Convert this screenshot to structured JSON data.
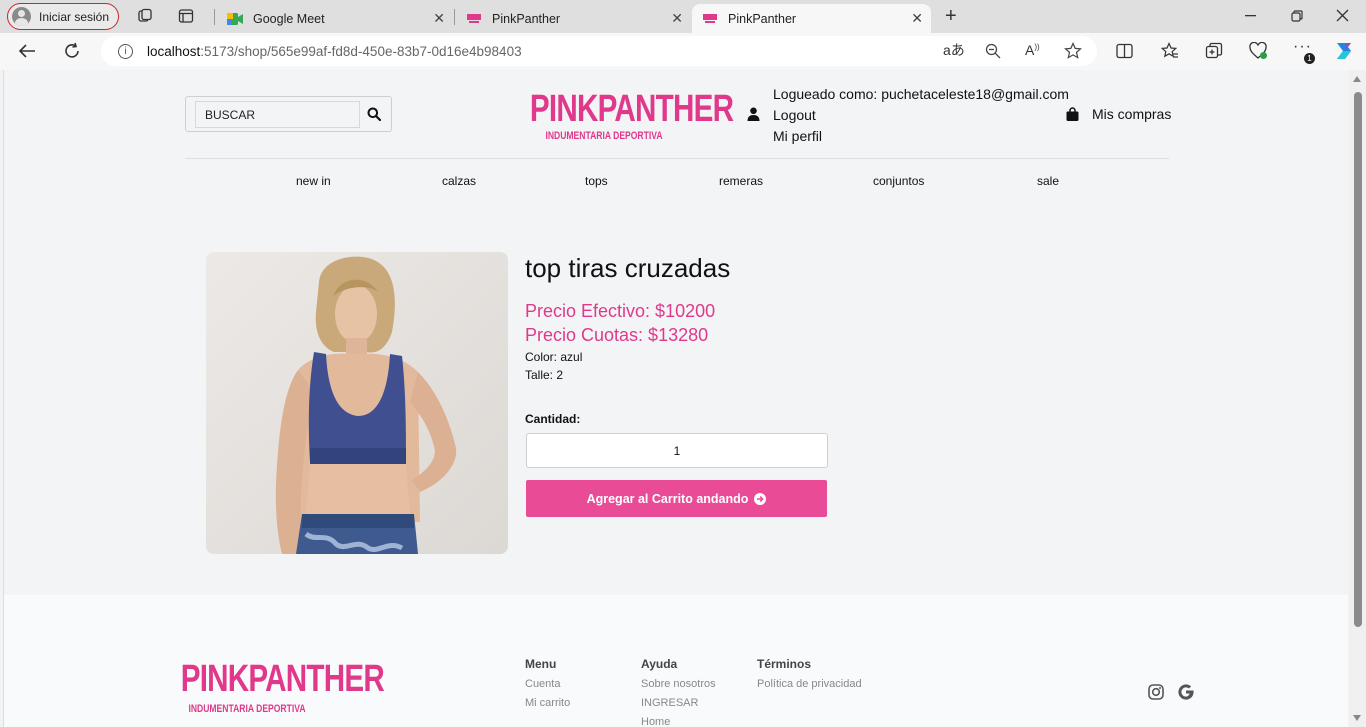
{
  "browser": {
    "profile_label": "Iniciar sesión",
    "tabs": [
      {
        "title": "Google Meet",
        "active": false
      },
      {
        "title": "PinkPanther",
        "active": false
      },
      {
        "title": "PinkPanther",
        "active": true
      }
    ],
    "new_tab_symbol": "+",
    "url_host": "localhost",
    "url_path": ":5173/shop/565e99af-fd8d-450e-83b7-0d16e4b98403",
    "extensions_badge": "1"
  },
  "header": {
    "search": {
      "placeholder": "BUSCAR",
      "value": ""
    },
    "logo": {
      "name": "PINKPANTHER",
      "tagline": "INDUMENTARIA DEPORTIVA"
    },
    "user": {
      "logged_as": "Logueado como: puchetaceleste18@gmail.com",
      "logout": "Logout",
      "profile": "Mi perfil"
    },
    "cart_label": "Mis compras"
  },
  "nav": [
    "new in",
    "calzas",
    "tops",
    "remeras",
    "conjuntos",
    "sale"
  ],
  "product": {
    "title": "top tiras cruzadas",
    "price_cash": "Precio Efectivo: $10200",
    "price_installments": "Precio Cuotas: $13280",
    "color": "Color: azul",
    "size": "Talle: 2",
    "quantity_label": "Cantidad:",
    "quantity": "1",
    "add_button": "Agregar al Carrito andando"
  },
  "footer": {
    "logo": {
      "name": "PINKPANTHER",
      "tagline": "INDUMENTARIA DEPORTIVA"
    },
    "columns": [
      {
        "title": "Menu",
        "links": [
          "Cuenta",
          "Mi carrito"
        ]
      },
      {
        "title": "Ayuda",
        "links": [
          "Sobre nosotros",
          "INGRESAR",
          "Home"
        ]
      },
      {
        "title": "Términos",
        "links": [
          "Política de privacidad"
        ]
      }
    ],
    "social_icons": [
      "instagram-icon",
      "google-icon"
    ]
  },
  "colors": {
    "brand_pink": "#e0398c",
    "button_pink": "#e94b97",
    "page_bg": "#f3f4f6"
  }
}
